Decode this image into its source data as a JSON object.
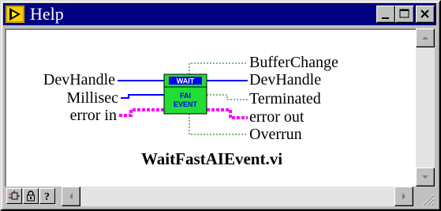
{
  "window": {
    "title": "Help",
    "title_bar_color": "#000080"
  },
  "title_buttons": [
    "minimize-icon",
    "maximize-icon",
    "close-icon"
  ],
  "diagram": {
    "inputs": [
      "DevHandle",
      "Millisec",
      "error in"
    ],
    "outputs": [
      "BufferChange",
      "DevHandle",
      "Terminated",
      "error out",
      "Overrun"
    ],
    "block_top_label": "WAIT",
    "block_bottom_label_line1": "FAI",
    "block_bottom_label_line2": "EVENT",
    "vi_name": "WaitFastAIEvent.vi",
    "block_color": "#22dd33",
    "error_wire_color": "#ff00ff",
    "int_wire_color": "#0000ff",
    "bool_wire_color": "#007000"
  },
  "toolbar": {
    "icons": [
      "simple-diagram-icon",
      "lock-icon",
      "question-mark-icon"
    ]
  }
}
